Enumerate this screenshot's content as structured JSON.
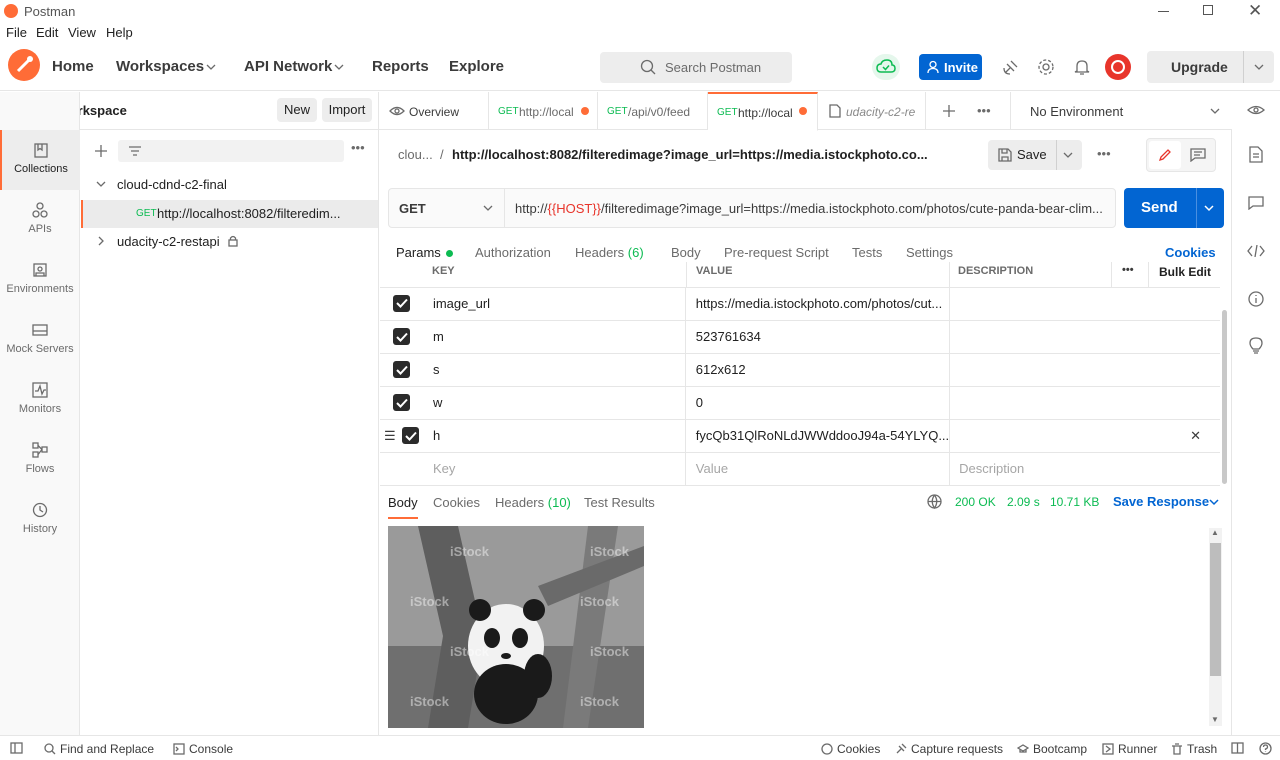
{
  "window": {
    "title": "Postman"
  },
  "menu": [
    "File",
    "Edit",
    "View",
    "Help"
  ],
  "header": {
    "nav": [
      "Home",
      "Workspaces",
      "API Network",
      "Reports",
      "Explore"
    ],
    "search_placeholder": "Search Postman",
    "invite_label": "Invite",
    "upgrade_label": "Upgrade"
  },
  "workspace": {
    "name": "My Workspace",
    "new_label": "New",
    "import_label": "Import"
  },
  "left_nav": [
    "Collections",
    "APIs",
    "Environments",
    "Mock Servers",
    "Monitors",
    "Flows",
    "History"
  ],
  "sidebar": {
    "collection1": "cloud-cdnd-c2-final",
    "request_method": "GET",
    "request_name": "http://localhost:8082/filteredim...",
    "collection2": "udacity-c2-restapi"
  },
  "tabs": {
    "overview": "Overview",
    "t1_method": "GET",
    "t1_label": "http://local",
    "t2_method": "GET",
    "t2_label": "/api/v0/feed",
    "t3_method": "GET",
    "t3_label": "http://local",
    "t4_label": "udacity-c2-re",
    "environment": "No Environment"
  },
  "request": {
    "breadcrumb_parent": "clou...",
    "breadcrumb_sep": "/",
    "breadcrumb_title": "http://localhost:8082/filteredimage?image_url=https://media.istockphoto.co...",
    "save_label": "Save",
    "method": "GET",
    "url_prefix": "http://",
    "url_var": "{{HOST}}",
    "url_rest": "/filteredimage?image_url=https://media.istockphoto.com/photos/cute-panda-bear-clim...",
    "send_label": "Send"
  },
  "param_tabs": {
    "params": "Params",
    "authorization": "Authorization",
    "headers": "Headers",
    "headers_count": "(6)",
    "body": "Body",
    "prerequest": "Pre-request Script",
    "tests": "Tests",
    "settings": "Settings",
    "cookies": "Cookies"
  },
  "params_table": {
    "headers": [
      "KEY",
      "VALUE",
      "DESCRIPTION"
    ],
    "bulk_edit": "Bulk Edit",
    "rows": [
      {
        "key": "image_url",
        "value": "https://media.istockphoto.com/photos/cut..."
      },
      {
        "key": "m",
        "value": "523761634"
      },
      {
        "key": "s",
        "value": "612x612"
      },
      {
        "key": "w",
        "value": "0"
      },
      {
        "key": "h",
        "value": "fycQb31QlRoNLdJWWddooJ94a-54YLYQ..."
      }
    ],
    "placeholder_key": "Key",
    "placeholder_value": "Value",
    "placeholder_desc": "Description"
  },
  "response": {
    "tabs": [
      "Body",
      "Cookies",
      "Headers",
      "Test Results"
    ],
    "headers_count": "(10)",
    "status": "200 OK",
    "time": "2.09 s",
    "size": "10.71 KB",
    "save_response": "Save Response",
    "watermark": "iStock"
  },
  "footer": {
    "find_replace": "Find and Replace",
    "console": "Console",
    "cookies": "Cookies",
    "capture": "Capture requests",
    "bootcamp": "Bootcamp",
    "runner": "Runner",
    "trash": "Trash"
  },
  "colors": {
    "brand": "#ff6c37",
    "primary": "#0265d2",
    "get": "#0cbb52",
    "status_ok": "#0cbb52"
  }
}
